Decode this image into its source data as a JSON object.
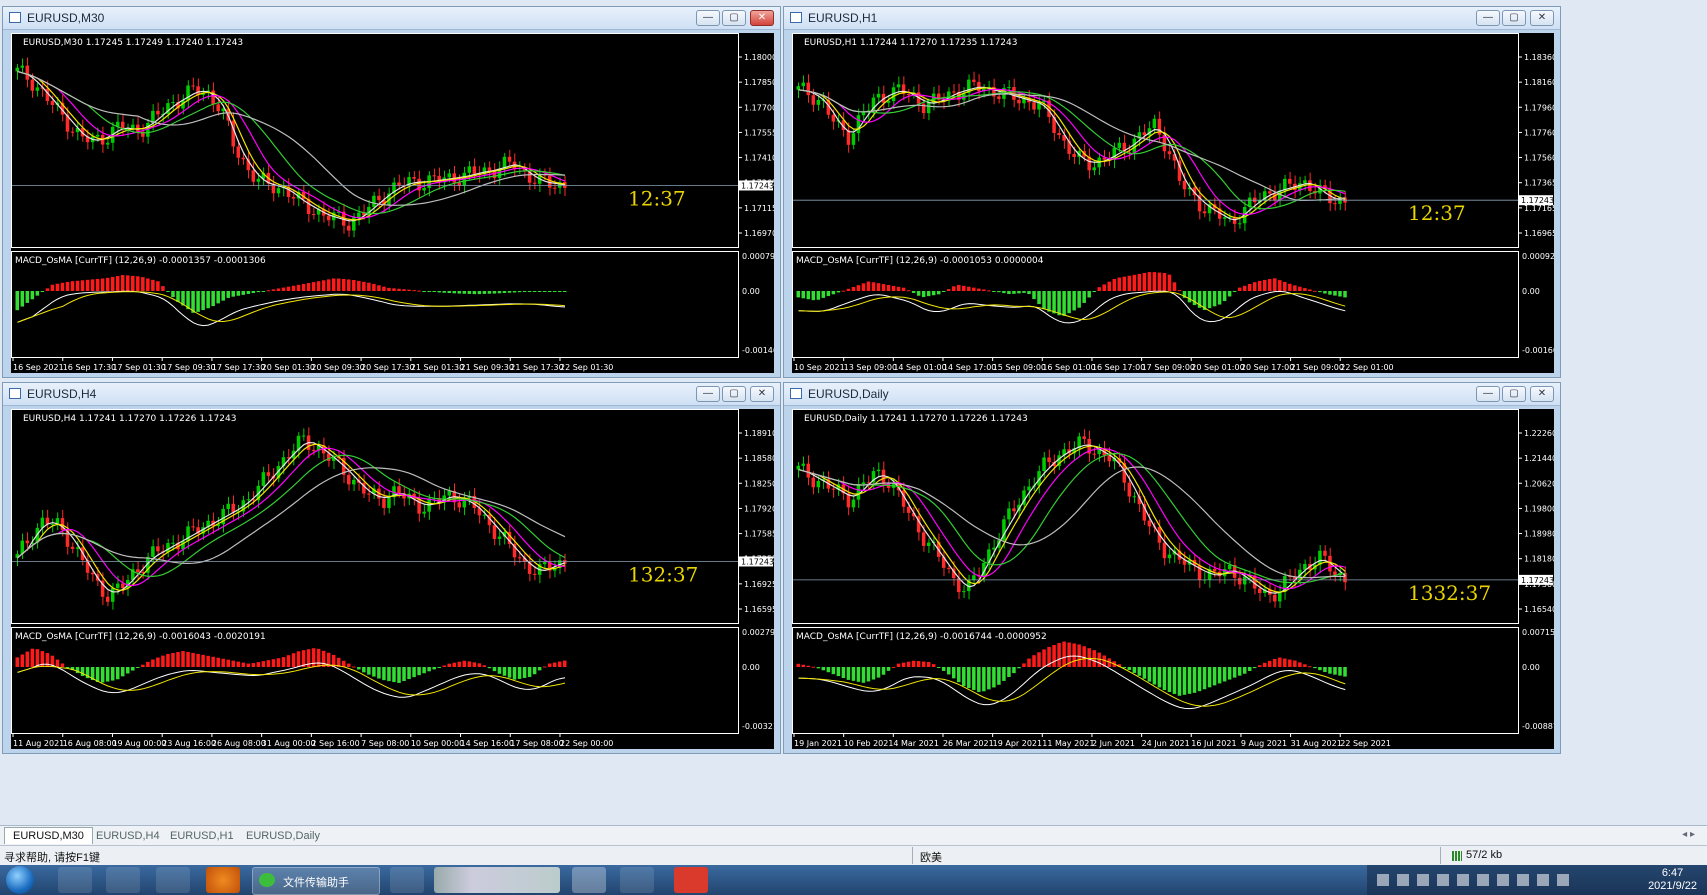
{
  "colors": {
    "ma_white": "#e6e6e6",
    "ma_yellow": "#f2e600",
    "ma_magenta": "#ff00ff",
    "ma_green": "#33cc33",
    "ma_gray": "#bdbdbd",
    "bull": "#00cc00",
    "bear": "#ff2a2a",
    "hist_pos": "#ff1a1a",
    "hist_neg": "#33dd33",
    "timer": "#e8d400",
    "bid_line": "#8aa0b4"
  },
  "windows": [
    {
      "id": "m30",
      "title": "EURUSD,M30",
      "header": "EURUSD,M30  1.17245 1.17249 1.17240 1.17243",
      "timer": "12:37",
      "price_labels": [
        "1.18000",
        "1.17850",
        "1.17700",
        "1.17555",
        "1.17410",
        "1.17265",
        "1.17115",
        "1.16970"
      ],
      "current_price": "1.17243",
      "macd_header": "MACD_OsMA [CurrTF] (12,26,9) -0.0001357 -0.0001306",
      "macd_labels": [
        "0.000792",
        "0.00",
        "-0.001468"
      ],
      "time_labels": [
        "16 Sep 2021",
        "16 Sep 17:30",
        "17 Sep 01:30",
        "17 Sep 09:30",
        "17 Sep 17:30",
        "20 Sep 01:30",
        "20 Sep 09:30",
        "20 Sep 17:30",
        "21 Sep 01:30",
        "21 Sep 09:30",
        "21 Sep 17:30",
        "22 Sep 01:30"
      ],
      "price_path": [
        0.9,
        0.86,
        0.78,
        0.7,
        0.62,
        0.54,
        0.52,
        0.55,
        0.6,
        0.58,
        0.6,
        0.66,
        0.72,
        0.76,
        0.8,
        0.78,
        0.7,
        0.5,
        0.38,
        0.3,
        0.28,
        0.26,
        0.2,
        0.16,
        0.12,
        0.1,
        0.08,
        0.12,
        0.18,
        0.24,
        0.28,
        0.3,
        0.3,
        0.31,
        0.32,
        0.33,
        0.35,
        0.36,
        0.38,
        0.4,
        0.34,
        0.3,
        0.29,
        0.28
      ],
      "macd_path": [
        -0.6,
        -0.2,
        0.2,
        0.3,
        0.35,
        0.4,
        0.5,
        0.45,
        0.3,
        -0.3,
        -0.7,
        -0.5,
        -0.2,
        -0.1,
        0.0,
        0.1,
        0.2,
        0.3,
        0.4,
        0.35,
        0.25,
        0.1,
        0.05,
        0.0,
        -0.05,
        -0.08,
        -0.1,
        -0.08,
        -0.05,
        -0.02,
        -0.03,
        -0.02
      ]
    },
    {
      "id": "h1",
      "title": "EURUSD,H1",
      "header": "EURUSD,H1  1.17244 1.17270 1.17235 1.17243",
      "timer": "12:37",
      "price_labels": [
        "1.18360",
        "1.18160",
        "1.17960",
        "1.17760",
        "1.17560",
        "1.17365",
        "1.17165",
        "1.16965"
      ],
      "current_price": "1.17243",
      "macd_header": "MACD_OsMA [CurrTF] (12,26,9) -0.0001053 0.0000004",
      "macd_labels": [
        "0.0009293",
        "0.00",
        "-0.001601"
      ],
      "time_labels": [
        "10 Sep 2021",
        "13 Sep 09:00",
        "14 Sep 01:00",
        "14 Sep 17:00",
        "15 Sep 09:00",
        "16 Sep 01:00",
        "16 Sep 17:00",
        "17 Sep 09:00",
        "20 Sep 01:00",
        "20 Sep 17:00",
        "21 Sep 09:00",
        "22 Sep 01:00"
      ],
      "price_path": [
        0.8,
        0.78,
        0.72,
        0.6,
        0.55,
        0.66,
        0.74,
        0.78,
        0.8,
        0.76,
        0.72,
        0.74,
        0.78,
        0.8,
        0.82,
        0.8,
        0.78,
        0.76,
        0.74,
        0.72,
        0.62,
        0.5,
        0.42,
        0.4,
        0.42,
        0.46,
        0.5,
        0.56,
        0.6,
        0.5,
        0.3,
        0.22,
        0.16,
        0.12,
        0.08,
        0.14,
        0.2,
        0.24,
        0.26,
        0.28,
        0.3,
        0.24,
        0.2,
        0.2
      ],
      "macd_path": [
        -0.2,
        -0.3,
        -0.1,
        0.1,
        0.3,
        0.2,
        0.1,
        -0.2,
        -0.1,
        0.2,
        0.1,
        0.0,
        -0.1,
        -0.05,
        -0.6,
        -0.8,
        -0.5,
        0.1,
        0.4,
        0.5,
        0.6,
        0.55,
        -0.3,
        -0.6,
        -0.4,
        0.1,
        0.3,
        0.4,
        0.2,
        0.05,
        -0.1,
        -0.2
      ]
    },
    {
      "id": "h4",
      "title": "EURUSD,H4",
      "header": "EURUSD,H4  1.17241 1.17270 1.17226 1.17243",
      "timer": "132:37",
      "price_labels": [
        "1.18910",
        "1.18580",
        "1.18250",
        "1.17920",
        "1.17585",
        "1.17255",
        "1.16925",
        "1.16595"
      ],
      "current_price": "1.17243",
      "macd_header": "MACD_OsMA [CurrTF] (12,26,9) -0.0016043 -0.0020191",
      "macd_labels": [
        "0.0027988",
        "0.00",
        "-0.003212"
      ],
      "time_labels": [
        "11 Aug 2021",
        "16 Aug 08:00",
        "19 Aug 00:00",
        "23 Aug 16:00",
        "26 Aug 08:00",
        "31 Aug 00:00",
        "2 Sep 16:00",
        "7 Sep 08:00",
        "10 Sep 00:00",
        "14 Sep 16:00",
        "17 Sep 08:00",
        "22 Sep 00:00"
      ],
      "price_path": [
        0.3,
        0.42,
        0.5,
        0.48,
        0.4,
        0.28,
        0.16,
        0.1,
        0.14,
        0.22,
        0.3,
        0.34,
        0.38,
        0.42,
        0.46,
        0.5,
        0.54,
        0.58,
        0.64,
        0.72,
        0.8,
        0.88,
        0.94,
        0.9,
        0.84,
        0.78,
        0.7,
        0.64,
        0.62,
        0.66,
        0.62,
        0.58,
        0.6,
        0.64,
        0.62,
        0.58,
        0.5,
        0.42,
        0.34,
        0.26,
        0.22,
        0.26,
        0.28
      ],
      "macd_path": [
        0.3,
        0.6,
        0.4,
        0.0,
        -0.3,
        -0.5,
        -0.4,
        -0.1,
        0.2,
        0.4,
        0.5,
        0.4,
        0.3,
        0.2,
        0.1,
        0.2,
        0.3,
        0.5,
        0.6,
        0.4,
        0.1,
        -0.2,
        -0.4,
        -0.5,
        -0.3,
        -0.1,
        0.1,
        0.2,
        0.1,
        -0.2,
        -0.4,
        -0.3,
        0.1,
        0.2
      ]
    },
    {
      "id": "d1",
      "title": "EURUSD,Daily",
      "header": "EURUSD,Daily  1.17241 1.17270 1.17226 1.17243",
      "timer": "1332:37",
      "price_labels": [
        "1.22260",
        "1.21440",
        "1.20620",
        "1.19800",
        "1.18980",
        "1.18180",
        "1.17360",
        "1.16540"
      ],
      "current_price": "1.17243",
      "macd_header": "MACD_OsMA [CurrTF] (12,26,9) -0.0016744 -0.0000952",
      "macd_labels": [
        "0.0071554",
        "0.00",
        "-0.008872"
      ],
      "time_labels": [
        "19 Jan 2021",
        "10 Feb 2021",
        "4 Mar 2021",
        "26 Mar 2021",
        "19 Apr 2021",
        "11 May 2021",
        "2 Jun 2021",
        "24 Jun 2021",
        "16 Jul 2021",
        "9 Aug 2021",
        "31 Aug 2021",
        "22 Sep 2021"
      ],
      "price_path": [
        0.78,
        0.74,
        0.7,
        0.66,
        0.62,
        0.7,
        0.76,
        0.72,
        0.6,
        0.48,
        0.38,
        0.28,
        0.18,
        0.12,
        0.24,
        0.38,
        0.5,
        0.62,
        0.72,
        0.8,
        0.86,
        0.9,
        0.92,
        0.88,
        0.84,
        0.74,
        0.6,
        0.46,
        0.36,
        0.3,
        0.26,
        0.22,
        0.2,
        0.24,
        0.2,
        0.14,
        0.1,
        0.12,
        0.2,
        0.26,
        0.3,
        0.24,
        0.18
      ],
      "macd_path": [
        0.1,
        0.0,
        -0.2,
        -0.4,
        -0.5,
        -0.3,
        0.1,
        0.2,
        0.15,
        -0.2,
        -0.6,
        -0.8,
        -0.6,
        -0.2,
        0.3,
        0.6,
        0.8,
        0.7,
        0.5,
        0.2,
        -0.1,
        -0.4,
        -0.7,
        -0.9,
        -0.8,
        -0.6,
        -0.4,
        -0.2,
        0.1,
        0.3,
        0.2,
        0.0,
        -0.2,
        -0.3
      ]
    }
  ],
  "window_buttons": {
    "min": "—",
    "max": "▢",
    "close": "✕"
  },
  "tabs": [
    "EURUSD,M30",
    "EURUSD,H4",
    "EURUSD,H1",
    "EURUSD,Daily"
  ],
  "tab_arrows": "◂ ▸",
  "status": {
    "help": "寻求帮助, 请按F1键",
    "profile": "欧美",
    "traffic": "57/2 kb"
  },
  "taskbar": {
    "wechat_label": "文件传输助手",
    "time": "6:47",
    "date": "2021/9/22"
  }
}
